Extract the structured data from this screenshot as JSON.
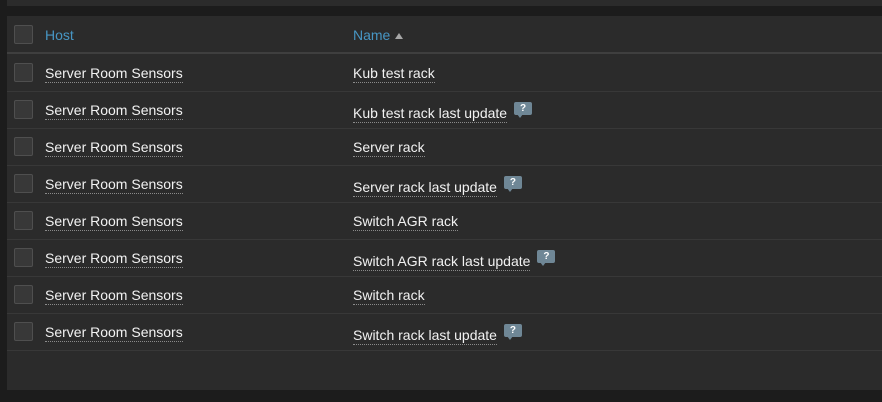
{
  "table": {
    "headers": {
      "host": "Host",
      "name": "Name"
    },
    "sort": {
      "column": "name",
      "direction": "ascending"
    },
    "rows": [
      {
        "host": "Server Room Sensors",
        "name": "Kub test rack",
        "has_hint": false
      },
      {
        "host": "Server Room Sensors",
        "name": "Kub test rack last update",
        "has_hint": true
      },
      {
        "host": "Server Room Sensors",
        "name": "Server rack",
        "has_hint": false
      },
      {
        "host": "Server Room Sensors",
        "name": "Server rack last update",
        "has_hint": true
      },
      {
        "host": "Server Room Sensors",
        "name": "Switch AGR rack",
        "has_hint": false
      },
      {
        "host": "Server Room Sensors",
        "name": "Switch AGR rack last update",
        "has_hint": true
      },
      {
        "host": "Server Room Sensors",
        "name": "Switch rack",
        "has_hint": false
      },
      {
        "host": "Server Room Sensors",
        "name": "Switch rack last update",
        "has_hint": true
      }
    ]
  },
  "icons": {
    "sort": "sort-ascending-icon",
    "hint": "help-hint-icon"
  },
  "colors": {
    "background": "#1c1c1c",
    "panel": "#2b2b2b",
    "header_link": "#4796c4",
    "text": "#f2f2f2",
    "hint_icon": "#6f8796"
  }
}
